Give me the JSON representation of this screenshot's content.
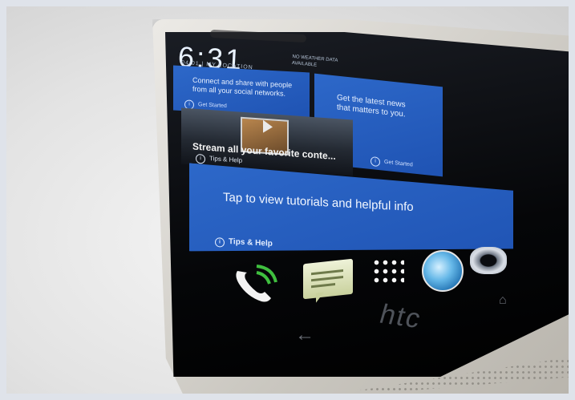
{
  "lockscreen": {
    "clock": "6:31",
    "date": "04/01 | MY LOCATION",
    "weather": "NO WEATHER DATA AVAILABLE"
  },
  "tiles": {
    "connect": {
      "text": "Connect and share with people from all your social networks.",
      "footer": "Get Started"
    },
    "news": {
      "text": "Get the latest news that matters to you.",
      "footer": "Get Started"
    },
    "video": {
      "title": "Stream all your favorite conte...",
      "footer": "Tips & Help"
    },
    "tips": {
      "text": "Tap to view tutorials and helpful info",
      "footer": "Tips & Help"
    }
  },
  "dock": {
    "icons": [
      "phone-icon",
      "messages-icon",
      "apps-icon",
      "browser-icon",
      "camera-icon"
    ]
  },
  "device": {
    "brand": "htc",
    "nav": [
      "back-icon",
      "home-icon"
    ]
  }
}
